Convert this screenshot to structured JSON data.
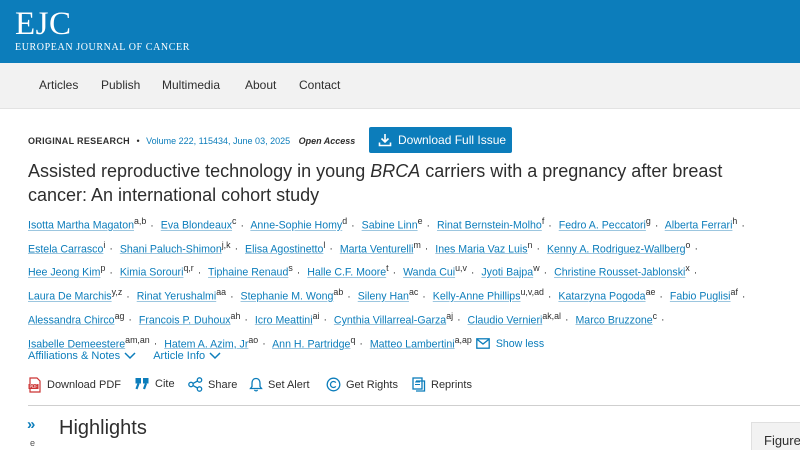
{
  "header": {
    "logo": "EJC",
    "logo_sub": "EUROPEAN JOURNAL OF CANCER",
    "brand_color": "#0c7dbb"
  },
  "nav": {
    "items": [
      "Articles",
      "Publish",
      "Multimedia",
      "About",
      "Contact"
    ]
  },
  "meta": {
    "type": "ORIGINAL RESEARCH",
    "volume": "Volume 222, 115434, June 03, 2025",
    "access": "Open Access",
    "download_label": "Download Full Issue"
  },
  "article": {
    "title_before": "Assisted reproductive technology in young ",
    "title_italic": "BRCA",
    "title_after": " carriers with a pregnancy after breast cancer: An international cohort study"
  },
  "authors": [
    {
      "name": "Isotta Martha Magaton",
      "sup": "a,b"
    },
    {
      "name": "Eva Blondeaux",
      "sup": "c"
    },
    {
      "name": "Anne-Sophie Homy",
      "sup": "d"
    },
    {
      "name": "Sabine Linn",
      "sup": "e"
    },
    {
      "name": "Rinat Bernstein-Molho",
      "sup": "f"
    },
    {
      "name": "Fedro A. Peccatori",
      "sup": "g"
    },
    {
      "name": "Alberta Ferrari",
      "sup": "h"
    },
    {
      "name": "Estela Carrasco",
      "sup": "i"
    },
    {
      "name": "Shani Paluch-Shimon",
      "sup": "j,k"
    },
    {
      "name": "Elisa Agostinetto",
      "sup": "l"
    },
    {
      "name": "Marta Venturelli",
      "sup": "m"
    },
    {
      "name": "Ines Maria Vaz Luis",
      "sup": "n"
    },
    {
      "name": "Kenny A. Rodriguez-Wallberg",
      "sup": "o"
    },
    {
      "name": "Hee Jeong Kim",
      "sup": "p"
    },
    {
      "name": "Kimia Sorouri",
      "sup": "q,r"
    },
    {
      "name": "Tiphaine Renaud",
      "sup": "s"
    },
    {
      "name": "Halle C.F. Moore",
      "sup": "t"
    },
    {
      "name": "Wanda Cui",
      "sup": "u,v"
    },
    {
      "name": "Jyoti Bajpa",
      "sup": "w"
    },
    {
      "name": "Christine Rousset-Jablonski",
      "sup": "x"
    },
    {
      "name": "Laura De Marchis",
      "sup": "y,z"
    },
    {
      "name": "Rinat Yerushalmi",
      "sup": "aa"
    },
    {
      "name": "Stephanie M. Wong",
      "sup": "ab"
    },
    {
      "name": "Sileny Han",
      "sup": "ac"
    },
    {
      "name": "Kelly-Anne Phillips",
      "sup": "u,v,ad"
    },
    {
      "name": "Katarzyna Pogoda",
      "sup": "ae"
    },
    {
      "name": "Fabio Puglisi",
      "sup": "af"
    },
    {
      "name": "Alessandra Chirco",
      "sup": "ag"
    },
    {
      "name": "Francois P. Duhoux",
      "sup": "ah"
    },
    {
      "name": "Icro Meattini",
      "sup": "ai"
    },
    {
      "name": "Cynthia Villarreal-Garza",
      "sup": "aj"
    },
    {
      "name": "Claudio Vernieri",
      "sup": "ak,al"
    },
    {
      "name": "Marco Bruzzone",
      "sup": "c"
    },
    {
      "name": "Isabelle Demeestere",
      "sup": "am,an"
    },
    {
      "name": "Hatem A. Azim, Jr",
      "sup": "ao"
    },
    {
      "name": "Ann H. Partridge",
      "sup": "q"
    },
    {
      "name": "Matteo Lambertini",
      "sup": "a,ap"
    }
  ],
  "show_less": "Show less",
  "aff": {
    "affiliations": "Affiliations & Notes",
    "article_info": "Article Info"
  },
  "toolbar": {
    "download_pdf": "Download PDF",
    "cite": "Cite",
    "share": "Share",
    "set_alert": "Set Alert",
    "get_rights": "Get Rights",
    "reprints": "Reprints"
  },
  "section": {
    "highlights": "Highlights",
    "figure_tab": "Figure"
  }
}
